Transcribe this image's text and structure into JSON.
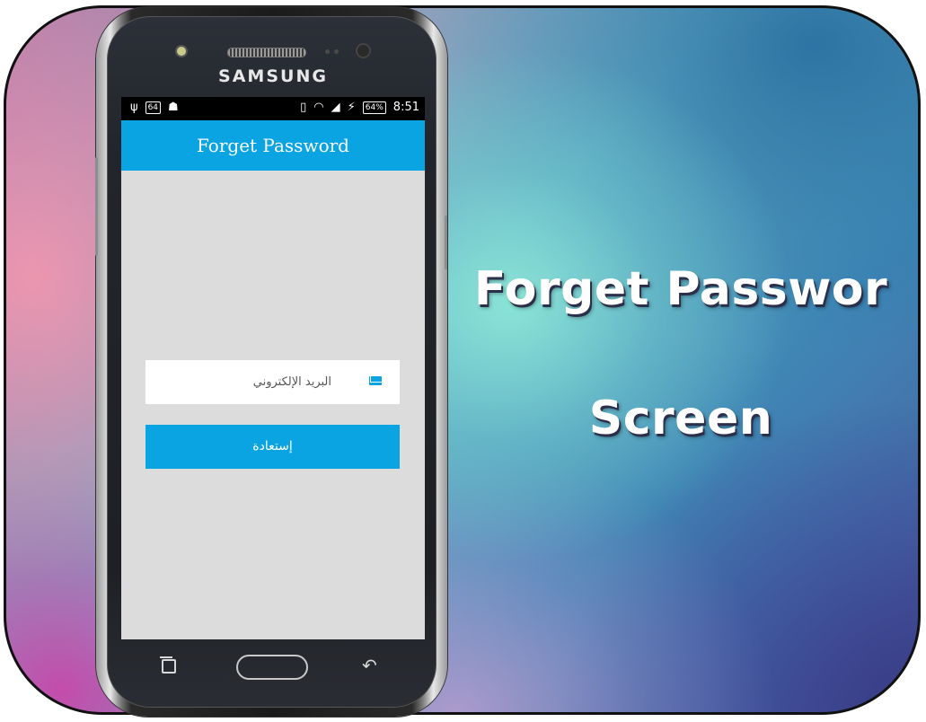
{
  "promo": {
    "headline_line1": "Forget Passwor",
    "headline_line2": "Screen"
  },
  "device": {
    "brand": "SAMSUNG"
  },
  "status_bar": {
    "badge_left": "64",
    "battery_percent": "64%",
    "time": "8:51"
  },
  "app": {
    "title": "Forget Password",
    "email_placeholder": "البريد الإلكتروني",
    "submit_label": "إستعادة",
    "accent_color": "#0aa4e2",
    "background_color": "#dcdcdc"
  }
}
